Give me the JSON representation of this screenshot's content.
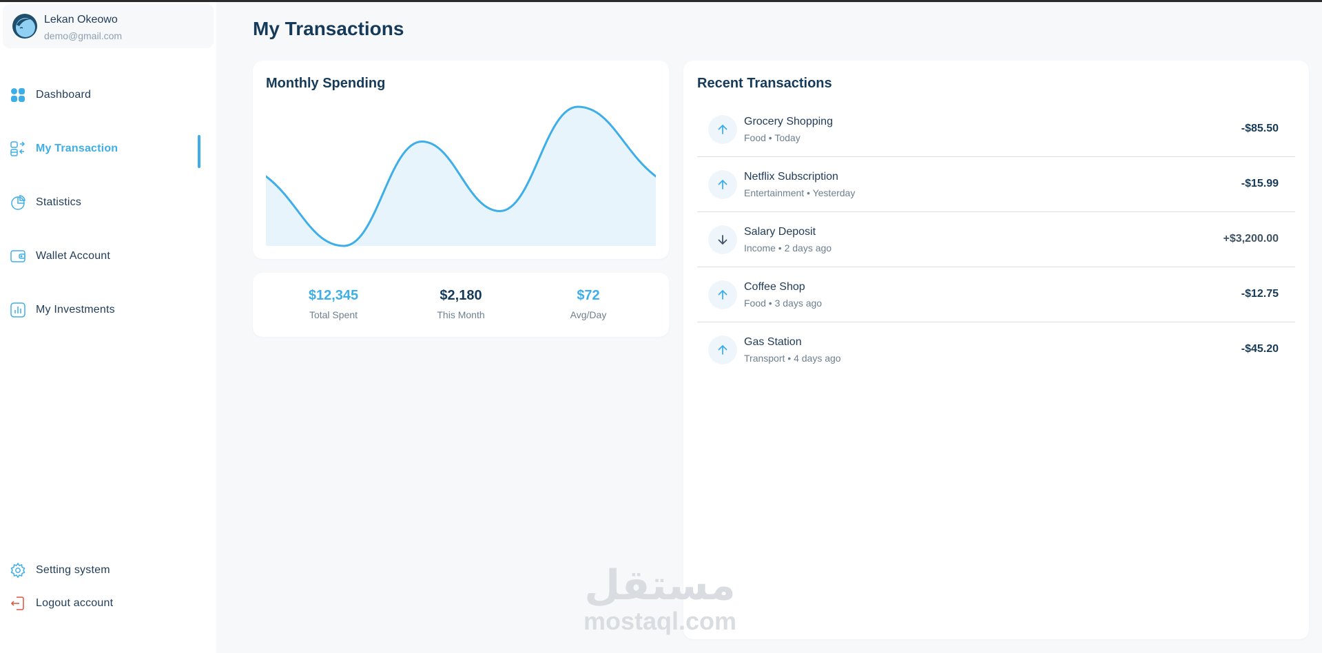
{
  "profile": {
    "name": "Lekan Okeowo",
    "email": "demo@gmail.com"
  },
  "nav": {
    "items": [
      {
        "label": "Dashboard",
        "icon": "grid-icon"
      },
      {
        "label": "My Transaction",
        "icon": "transaction-icon",
        "active": true
      },
      {
        "label": "Statistics",
        "icon": "pie-chart-icon"
      },
      {
        "label": "Wallet Account",
        "icon": "wallet-icon"
      },
      {
        "label": "My Investments",
        "icon": "bar-chart-icon"
      }
    ],
    "bottom": [
      {
        "label": "Setting system",
        "icon": "gear-icon"
      },
      {
        "label": "Logout account",
        "icon": "logout-icon"
      }
    ]
  },
  "page": {
    "title": "My Transactions"
  },
  "spending": {
    "title": "Monthly Spending"
  },
  "chart_data": {
    "type": "area",
    "title": "Monthly Spending",
    "series": [
      {
        "values": [
          50,
          0,
          75,
          25,
          100,
          50
        ]
      }
    ],
    "ylim": [
      0,
      100
    ],
    "grid": false,
    "axes_visible": false
  },
  "stats": [
    {
      "value": "$12,345",
      "label": "Total Spent",
      "accent": true
    },
    {
      "value": "$2,180",
      "label": "This Month",
      "accent": false
    },
    {
      "value": "$72",
      "label": "Avg/Day",
      "accent": true
    }
  ],
  "recent": {
    "title": "Recent Transactions",
    "items": [
      {
        "name": "Grocery Shopping",
        "meta": "Food • Today",
        "amount": "-$85.50",
        "direction": "up"
      },
      {
        "name": "Netflix Subscription",
        "meta": "Entertainment • Yesterday",
        "amount": "-$15.99",
        "direction": "up"
      },
      {
        "name": "Salary Deposit",
        "meta": "Income • 2 days ago",
        "amount": "+$3,200.00",
        "direction": "down"
      },
      {
        "name": "Coffee Shop",
        "meta": "Food • 3 days ago",
        "amount": "-$12.75",
        "direction": "up"
      },
      {
        "name": "Gas Station",
        "meta": "Transport • 4 days ago",
        "amount": "-$45.20",
        "direction": "up"
      }
    ]
  },
  "watermark": {
    "arabic": "مستقل",
    "latin": "mostaql.com"
  },
  "colors": {
    "accent": "#3eaee8",
    "title": "#163a5a",
    "fill": "#e8f4fc",
    "debit_arrow": "#3eaee8",
    "credit_arrow": "#3f5366"
  }
}
